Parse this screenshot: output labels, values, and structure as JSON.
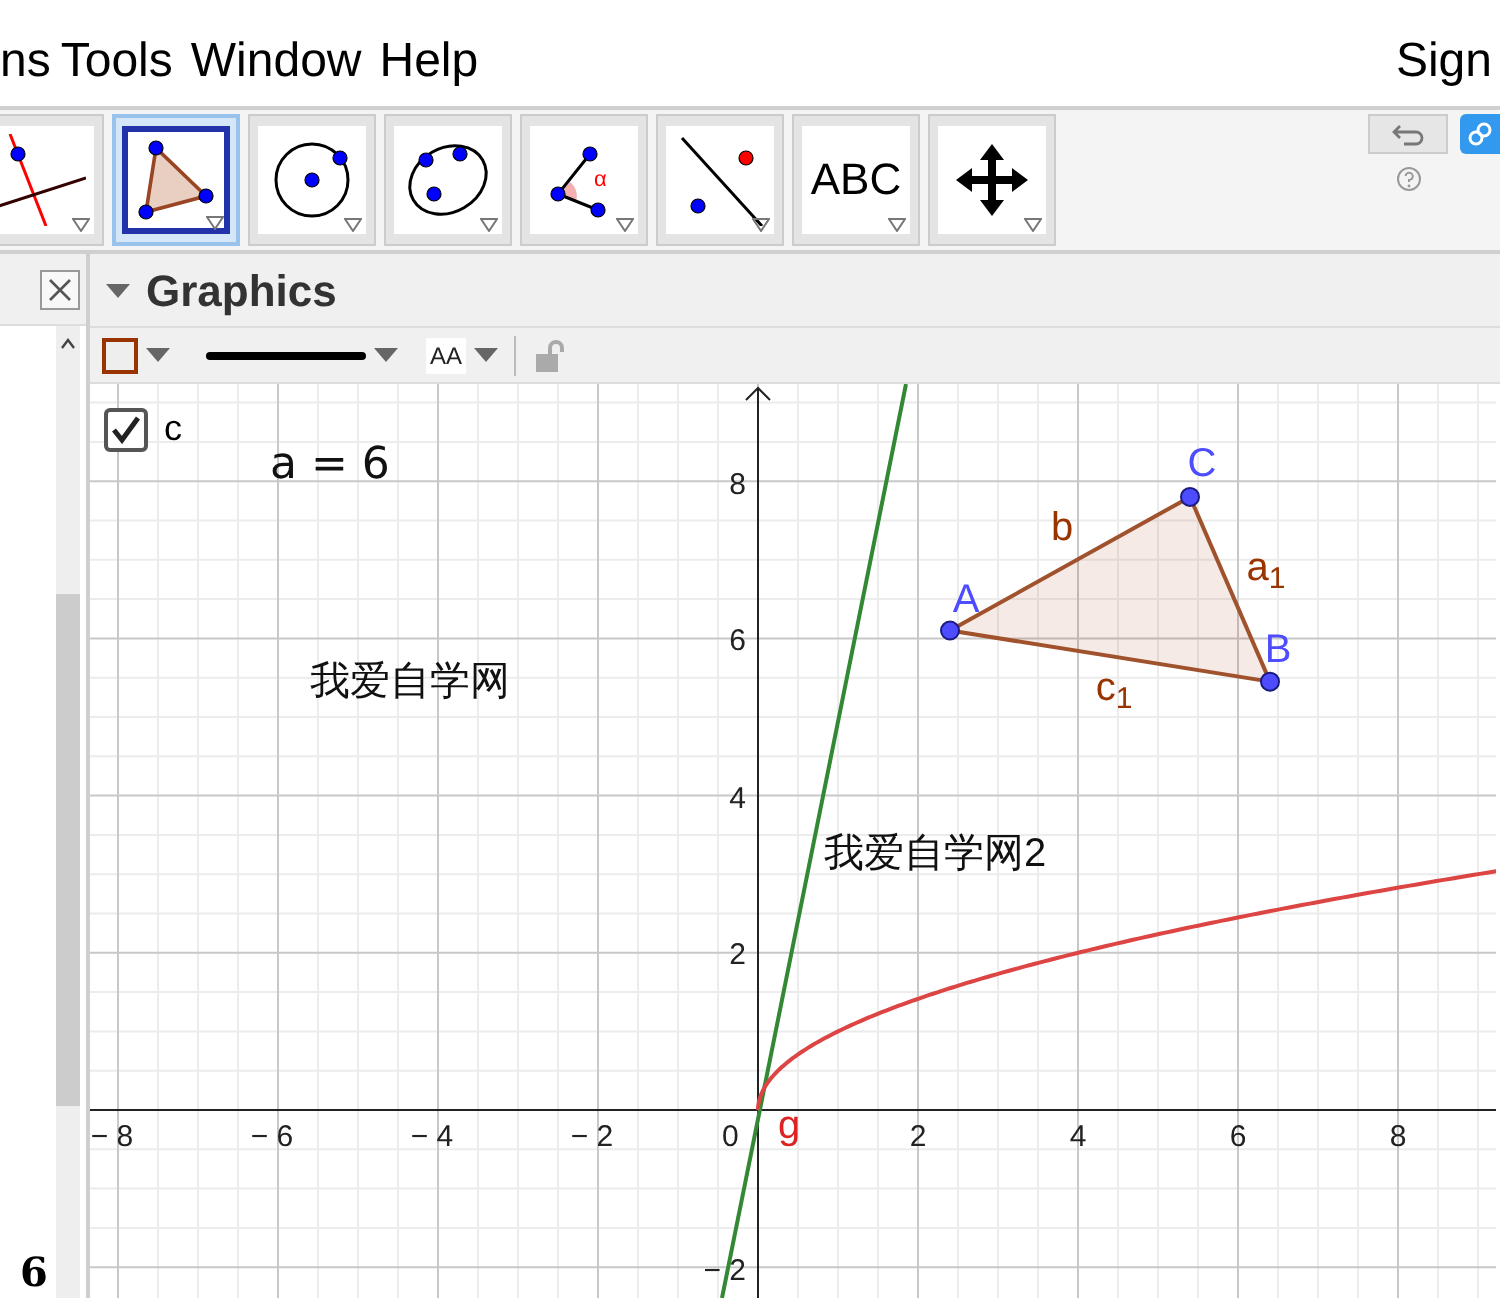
{
  "menu_bar": {
    "items": [
      "ns",
      "Tools",
      "Window",
      "Help"
    ],
    "sign_in": "Sign"
  },
  "toolbar": {
    "tools": [
      {
        "kind": "line",
        "selected": false
      },
      {
        "kind": "polygon",
        "selected": true
      },
      {
        "kind": "circle",
        "selected": false
      },
      {
        "kind": "conic",
        "selected": false
      },
      {
        "kind": "angle",
        "selected": false,
        "label": "α"
      },
      {
        "kind": "reflect",
        "selected": false
      },
      {
        "kind": "text",
        "selected": false,
        "label": "ABC"
      },
      {
        "kind": "move",
        "selected": false
      }
    ]
  },
  "algebra": {
    "value": "6"
  },
  "graphics": {
    "title": "Graphics",
    "style_bar": {
      "label_style": "AA"
    }
  },
  "canvas": {
    "checkbox": {
      "label": "c",
      "checked": true
    },
    "texts": [
      {
        "text": "a = 6"
      },
      {
        "text": "我爱自学网"
      },
      {
        "text": "我爱自学网2"
      }
    ],
    "points": [
      {
        "label": "A"
      },
      {
        "label": "B"
      },
      {
        "label": "C"
      }
    ],
    "segments": [
      {
        "label": "a$_{1}$"
      },
      {
        "label": "b"
      },
      {
        "label": "c$_{1}$"
      }
    ],
    "functions": [
      {
        "label": "g"
      }
    ],
    "x_ticks": [
      "− 8",
      "− 6",
      "− 4",
      "− 2",
      "2",
      "4",
      "6",
      "8"
    ],
    "y_ticks": [
      "8",
      "6",
      "4",
      "2",
      "− 2"
    ],
    "origin": "0"
  }
}
